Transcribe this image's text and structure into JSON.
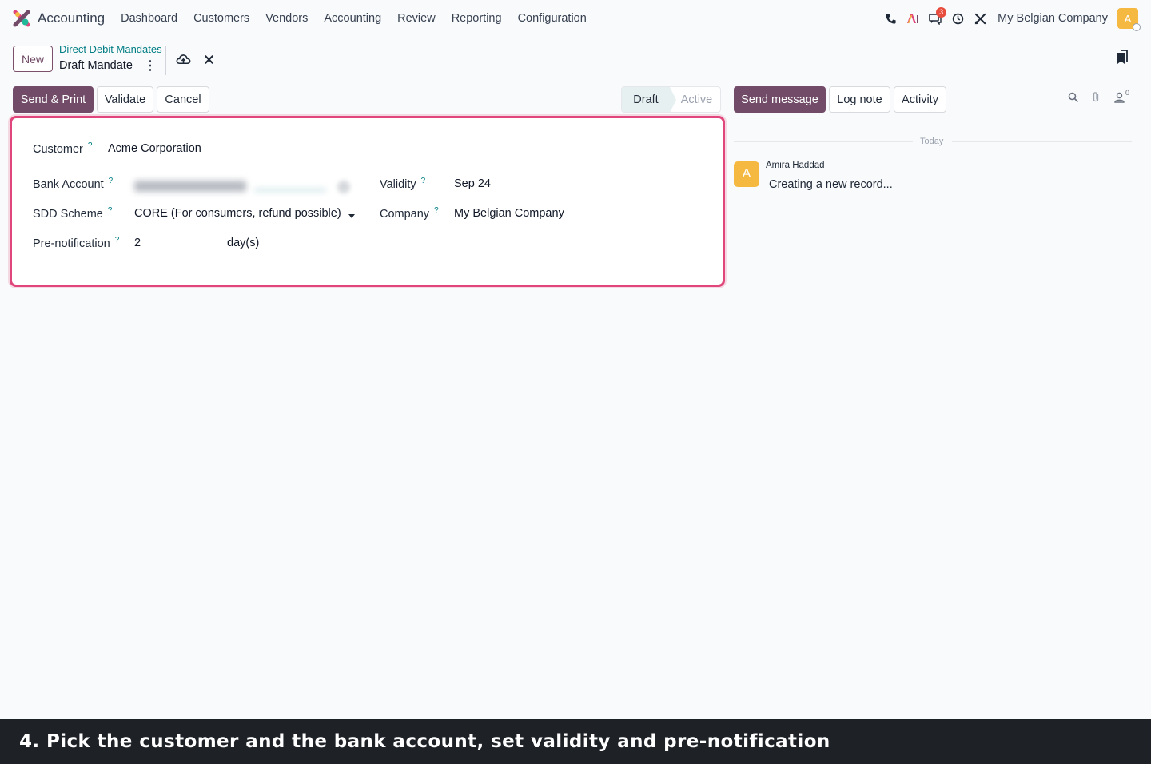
{
  "app": {
    "name": "Accounting",
    "menu": [
      "Dashboard",
      "Customers",
      "Vendors",
      "Accounting",
      "Review",
      "Reporting",
      "Configuration"
    ],
    "messages_badge": "3",
    "company": "My Belgian Company",
    "user_initial": "A",
    "brand_colors": {
      "primary": "#714b67",
      "link": "#017e84",
      "highlight": "#e0457b",
      "avatar": "#f5b942"
    }
  },
  "control_panel": {
    "new_label": "New",
    "breadcrumb": "Direct Debit Mandates",
    "record_title": "Draft Mandate"
  },
  "actions": {
    "send_print": "Send & Print",
    "validate": "Validate",
    "cancel": "Cancel"
  },
  "status": {
    "steps": [
      "Draft",
      "Active"
    ],
    "current": "Draft"
  },
  "form": {
    "customer_label": "Customer",
    "customer_value": "Acme Corporation",
    "bank_account_label": "Bank Account",
    "sdd_scheme_label": "SDD Scheme",
    "sdd_scheme_value": "CORE (For consumers, refund possible)",
    "prenotification_label": "Pre-notification",
    "prenotification_value": "2",
    "prenotification_unit": "day(s)",
    "validity_label": "Validity",
    "validity_value": "Sep 24",
    "company_label": "Company",
    "company_value": "My Belgian Company",
    "help_mark": "?"
  },
  "chatter": {
    "send_message": "Send message",
    "log_note": "Log note",
    "activity": "Activity",
    "followers_count": "0",
    "separator": "Today",
    "message": {
      "author": "Amira Haddad",
      "avatar_initial": "A",
      "body": "Creating a new record..."
    }
  },
  "caption": "4. Pick the customer and the bank account, set validity and pre-notification"
}
